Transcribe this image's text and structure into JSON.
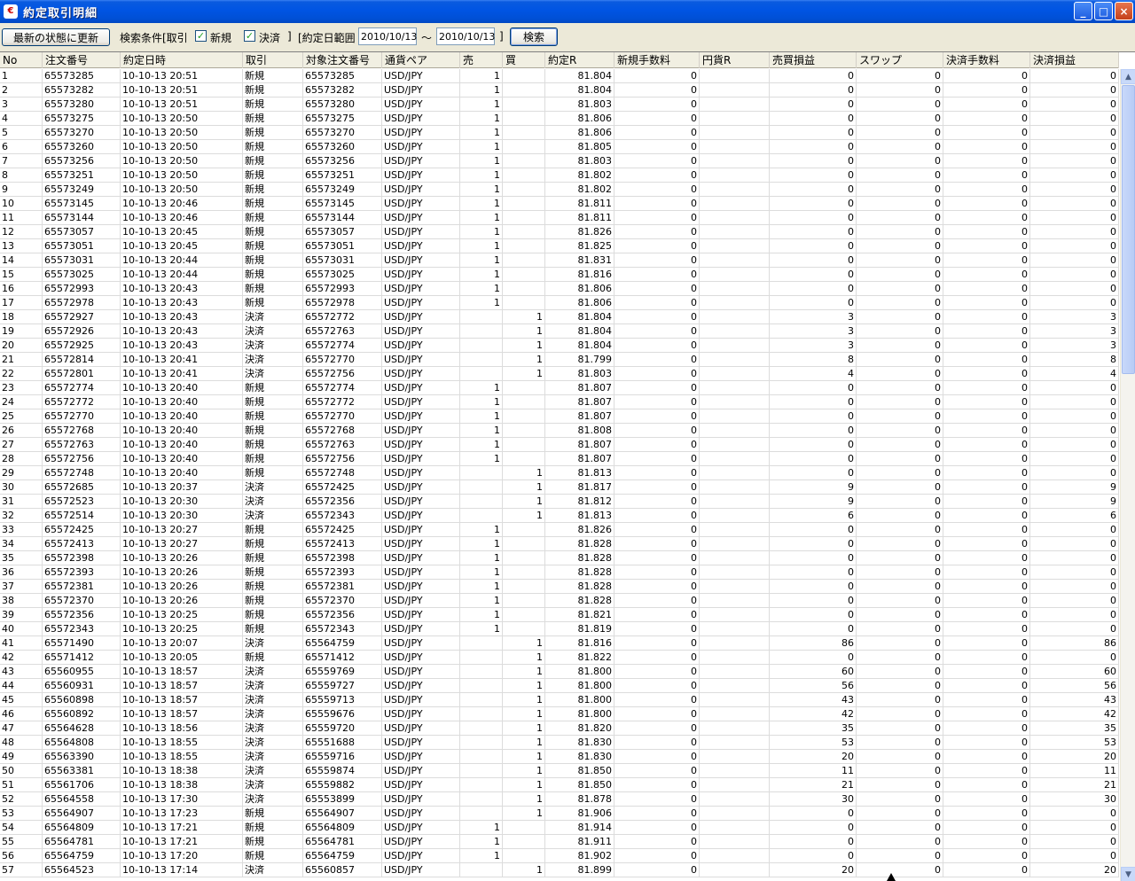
{
  "window": {
    "title": "約定取引明細",
    "icon": "app-icon",
    "min": "_",
    "max": "□",
    "close": "×"
  },
  "toolbar": {
    "refresh_label": "最新の状態に更新",
    "search_cond": "検索条件[取引",
    "chk_new_label": "新規",
    "chk_settle_label": "決済",
    "bracket_close": "]",
    "date_range_label": "[約定日範囲",
    "date_from": "2010/10/13",
    "tilde": "～",
    "date_to": "2010/10/13",
    "bracket_end": "]",
    "search_label": "検索",
    "check_mark": "✓"
  },
  "columns": [
    "No",
    "注文番号",
    "約定日時",
    "取引",
    "対象注文番号",
    "通貨ペア",
    "売",
    "買",
    "約定R",
    "新規手数料",
    "円貨R",
    "売買損益",
    "スワップ",
    "決済手数料",
    "決済損益"
  ],
  "rows": [
    [
      "1",
      "65573285",
      "10-10-13 20:51",
      "新規",
      "65573285",
      "USD/JPY",
      "1",
      "",
      "81.804",
      "0",
      "",
      "0",
      "0",
      "0",
      "0"
    ],
    [
      "2",
      "65573282",
      "10-10-13 20:51",
      "新規",
      "65573282",
      "USD/JPY",
      "1",
      "",
      "81.804",
      "0",
      "",
      "0",
      "0",
      "0",
      "0"
    ],
    [
      "3",
      "65573280",
      "10-10-13 20:51",
      "新規",
      "65573280",
      "USD/JPY",
      "1",
      "",
      "81.803",
      "0",
      "",
      "0",
      "0",
      "0",
      "0"
    ],
    [
      "4",
      "65573275",
      "10-10-13 20:50",
      "新規",
      "65573275",
      "USD/JPY",
      "1",
      "",
      "81.806",
      "0",
      "",
      "0",
      "0",
      "0",
      "0"
    ],
    [
      "5",
      "65573270",
      "10-10-13 20:50",
      "新規",
      "65573270",
      "USD/JPY",
      "1",
      "",
      "81.806",
      "0",
      "",
      "0",
      "0",
      "0",
      "0"
    ],
    [
      "6",
      "65573260",
      "10-10-13 20:50",
      "新規",
      "65573260",
      "USD/JPY",
      "1",
      "",
      "81.805",
      "0",
      "",
      "0",
      "0",
      "0",
      "0"
    ],
    [
      "7",
      "65573256",
      "10-10-13 20:50",
      "新規",
      "65573256",
      "USD/JPY",
      "1",
      "",
      "81.803",
      "0",
      "",
      "0",
      "0",
      "0",
      "0"
    ],
    [
      "8",
      "65573251",
      "10-10-13 20:50",
      "新規",
      "65573251",
      "USD/JPY",
      "1",
      "",
      "81.802",
      "0",
      "",
      "0",
      "0",
      "0",
      "0"
    ],
    [
      "9",
      "65573249",
      "10-10-13 20:50",
      "新規",
      "65573249",
      "USD/JPY",
      "1",
      "",
      "81.802",
      "0",
      "",
      "0",
      "0",
      "0",
      "0"
    ],
    [
      "10",
      "65573145",
      "10-10-13 20:46",
      "新規",
      "65573145",
      "USD/JPY",
      "1",
      "",
      "81.811",
      "0",
      "",
      "0",
      "0",
      "0",
      "0"
    ],
    [
      "11",
      "65573144",
      "10-10-13 20:46",
      "新規",
      "65573144",
      "USD/JPY",
      "1",
      "",
      "81.811",
      "0",
      "",
      "0",
      "0",
      "0",
      "0"
    ],
    [
      "12",
      "65573057",
      "10-10-13 20:45",
      "新規",
      "65573057",
      "USD/JPY",
      "1",
      "",
      "81.826",
      "0",
      "",
      "0",
      "0",
      "0",
      "0"
    ],
    [
      "13",
      "65573051",
      "10-10-13 20:45",
      "新規",
      "65573051",
      "USD/JPY",
      "1",
      "",
      "81.825",
      "0",
      "",
      "0",
      "0",
      "0",
      "0"
    ],
    [
      "14",
      "65573031",
      "10-10-13 20:44",
      "新規",
      "65573031",
      "USD/JPY",
      "1",
      "",
      "81.831",
      "0",
      "",
      "0",
      "0",
      "0",
      "0"
    ],
    [
      "15",
      "65573025",
      "10-10-13 20:44",
      "新規",
      "65573025",
      "USD/JPY",
      "1",
      "",
      "81.816",
      "0",
      "",
      "0",
      "0",
      "0",
      "0"
    ],
    [
      "16",
      "65572993",
      "10-10-13 20:43",
      "新規",
      "65572993",
      "USD/JPY",
      "1",
      "",
      "81.806",
      "0",
      "",
      "0",
      "0",
      "0",
      "0"
    ],
    [
      "17",
      "65572978",
      "10-10-13 20:43",
      "新規",
      "65572978",
      "USD/JPY",
      "1",
      "",
      "81.806",
      "0",
      "",
      "0",
      "0",
      "0",
      "0"
    ],
    [
      "18",
      "65572927",
      "10-10-13 20:43",
      "決済",
      "65572772",
      "USD/JPY",
      "",
      "1",
      "81.804",
      "0",
      "",
      "3",
      "0",
      "0",
      "3"
    ],
    [
      "19",
      "65572926",
      "10-10-13 20:43",
      "決済",
      "65572763",
      "USD/JPY",
      "",
      "1",
      "81.804",
      "0",
      "",
      "3",
      "0",
      "0",
      "3"
    ],
    [
      "20",
      "65572925",
      "10-10-13 20:43",
      "決済",
      "65572774",
      "USD/JPY",
      "",
      "1",
      "81.804",
      "0",
      "",
      "3",
      "0",
      "0",
      "3"
    ],
    [
      "21",
      "65572814",
      "10-10-13 20:41",
      "決済",
      "65572770",
      "USD/JPY",
      "",
      "1",
      "81.799",
      "0",
      "",
      "8",
      "0",
      "0",
      "8"
    ],
    [
      "22",
      "65572801",
      "10-10-13 20:41",
      "決済",
      "65572756",
      "USD/JPY",
      "",
      "1",
      "81.803",
      "0",
      "",
      "4",
      "0",
      "0",
      "4"
    ],
    [
      "23",
      "65572774",
      "10-10-13 20:40",
      "新規",
      "65572774",
      "USD/JPY",
      "1",
      "",
      "81.807",
      "0",
      "",
      "0",
      "0",
      "0",
      "0"
    ],
    [
      "24",
      "65572772",
      "10-10-13 20:40",
      "新規",
      "65572772",
      "USD/JPY",
      "1",
      "",
      "81.807",
      "0",
      "",
      "0",
      "0",
      "0",
      "0"
    ],
    [
      "25",
      "65572770",
      "10-10-13 20:40",
      "新規",
      "65572770",
      "USD/JPY",
      "1",
      "",
      "81.807",
      "0",
      "",
      "0",
      "0",
      "0",
      "0"
    ],
    [
      "26",
      "65572768",
      "10-10-13 20:40",
      "新規",
      "65572768",
      "USD/JPY",
      "1",
      "",
      "81.808",
      "0",
      "",
      "0",
      "0",
      "0",
      "0"
    ],
    [
      "27",
      "65572763",
      "10-10-13 20:40",
      "新規",
      "65572763",
      "USD/JPY",
      "1",
      "",
      "81.807",
      "0",
      "",
      "0",
      "0",
      "0",
      "0"
    ],
    [
      "28",
      "65572756",
      "10-10-13 20:40",
      "新規",
      "65572756",
      "USD/JPY",
      "1",
      "",
      "81.807",
      "0",
      "",
      "0",
      "0",
      "0",
      "0"
    ],
    [
      "29",
      "65572748",
      "10-10-13 20:40",
      "新規",
      "65572748",
      "USD/JPY",
      "",
      "1",
      "81.813",
      "0",
      "",
      "0",
      "0",
      "0",
      "0"
    ],
    [
      "30",
      "65572685",
      "10-10-13 20:37",
      "決済",
      "65572425",
      "USD/JPY",
      "",
      "1",
      "81.817",
      "0",
      "",
      "9",
      "0",
      "0",
      "9"
    ],
    [
      "31",
      "65572523",
      "10-10-13 20:30",
      "決済",
      "65572356",
      "USD/JPY",
      "",
      "1",
      "81.812",
      "0",
      "",
      "9",
      "0",
      "0",
      "9"
    ],
    [
      "32",
      "65572514",
      "10-10-13 20:30",
      "決済",
      "65572343",
      "USD/JPY",
      "",
      "1",
      "81.813",
      "0",
      "",
      "6",
      "0",
      "0",
      "6"
    ],
    [
      "33",
      "65572425",
      "10-10-13 20:27",
      "新規",
      "65572425",
      "USD/JPY",
      "1",
      "",
      "81.826",
      "0",
      "",
      "0",
      "0",
      "0",
      "0"
    ],
    [
      "34",
      "65572413",
      "10-10-13 20:27",
      "新規",
      "65572413",
      "USD/JPY",
      "1",
      "",
      "81.828",
      "0",
      "",
      "0",
      "0",
      "0",
      "0"
    ],
    [
      "35",
      "65572398",
      "10-10-13 20:26",
      "新規",
      "65572398",
      "USD/JPY",
      "1",
      "",
      "81.828",
      "0",
      "",
      "0",
      "0",
      "0",
      "0"
    ],
    [
      "36",
      "65572393",
      "10-10-13 20:26",
      "新規",
      "65572393",
      "USD/JPY",
      "1",
      "",
      "81.828",
      "0",
      "",
      "0",
      "0",
      "0",
      "0"
    ],
    [
      "37",
      "65572381",
      "10-10-13 20:26",
      "新規",
      "65572381",
      "USD/JPY",
      "1",
      "",
      "81.828",
      "0",
      "",
      "0",
      "0",
      "0",
      "0"
    ],
    [
      "38",
      "65572370",
      "10-10-13 20:26",
      "新規",
      "65572370",
      "USD/JPY",
      "1",
      "",
      "81.828",
      "0",
      "",
      "0",
      "0",
      "0",
      "0"
    ],
    [
      "39",
      "65572356",
      "10-10-13 20:25",
      "新規",
      "65572356",
      "USD/JPY",
      "1",
      "",
      "81.821",
      "0",
      "",
      "0",
      "0",
      "0",
      "0"
    ],
    [
      "40",
      "65572343",
      "10-10-13 20:25",
      "新規",
      "65572343",
      "USD/JPY",
      "1",
      "",
      "81.819",
      "0",
      "",
      "0",
      "0",
      "0",
      "0"
    ],
    [
      "41",
      "65571490",
      "10-10-13 20:07",
      "決済",
      "65564759",
      "USD/JPY",
      "",
      "1",
      "81.816",
      "0",
      "",
      "86",
      "0",
      "0",
      "86"
    ],
    [
      "42",
      "65571412",
      "10-10-13 20:05",
      "新規",
      "65571412",
      "USD/JPY",
      "",
      "1",
      "81.822",
      "0",
      "",
      "0",
      "0",
      "0",
      "0"
    ],
    [
      "43",
      "65560955",
      "10-10-13 18:57",
      "決済",
      "65559769",
      "USD/JPY",
      "",
      "1",
      "81.800",
      "0",
      "",
      "60",
      "0",
      "0",
      "60"
    ],
    [
      "44",
      "65560931",
      "10-10-13 18:57",
      "決済",
      "65559727",
      "USD/JPY",
      "",
      "1",
      "81.800",
      "0",
      "",
      "56",
      "0",
      "0",
      "56"
    ],
    [
      "45",
      "65560898",
      "10-10-13 18:57",
      "決済",
      "65559713",
      "USD/JPY",
      "",
      "1",
      "81.800",
      "0",
      "",
      "43",
      "0",
      "0",
      "43"
    ],
    [
      "46",
      "65560892",
      "10-10-13 18:57",
      "決済",
      "65559676",
      "USD/JPY",
      "",
      "1",
      "81.800",
      "0",
      "",
      "42",
      "0",
      "0",
      "42"
    ],
    [
      "47",
      "65564628",
      "10-10-13 18:56",
      "決済",
      "65559720",
      "USD/JPY",
      "",
      "1",
      "81.820",
      "0",
      "",
      "35",
      "0",
      "0",
      "35"
    ],
    [
      "48",
      "65564808",
      "10-10-13 18:55",
      "決済",
      "65551688",
      "USD/JPY",
      "",
      "1",
      "81.830",
      "0",
      "",
      "53",
      "0",
      "0",
      "53"
    ],
    [
      "49",
      "65563390",
      "10-10-13 18:55",
      "決済",
      "65559716",
      "USD/JPY",
      "",
      "1",
      "81.830",
      "0",
      "",
      "20",
      "0",
      "0",
      "20"
    ],
    [
      "50",
      "65563381",
      "10-10-13 18:38",
      "決済",
      "65559874",
      "USD/JPY",
      "",
      "1",
      "81.850",
      "0",
      "",
      "11",
      "0",
      "0",
      "11"
    ],
    [
      "51",
      "65561706",
      "10-10-13 18:38",
      "決済",
      "65559882",
      "USD/JPY",
      "",
      "1",
      "81.850",
      "0",
      "",
      "21",
      "0",
      "0",
      "21"
    ],
    [
      "52",
      "65564558",
      "10-10-13 17:30",
      "決済",
      "65553899",
      "USD/JPY",
      "",
      "1",
      "81.878",
      "0",
      "",
      "30",
      "0",
      "0",
      "30"
    ],
    [
      "53",
      "65564907",
      "10-10-13 17:23",
      "新規",
      "65564907",
      "USD/JPY",
      "",
      "1",
      "81.906",
      "0",
      "",
      "0",
      "0",
      "0",
      "0"
    ],
    [
      "54",
      "65564809",
      "10-10-13 17:21",
      "新規",
      "65564809",
      "USD/JPY",
      "1",
      "",
      "81.914",
      "0",
      "",
      "0",
      "0",
      "0",
      "0"
    ],
    [
      "55",
      "65564781",
      "10-10-13 17:21",
      "新規",
      "65564781",
      "USD/JPY",
      "1",
      "",
      "81.911",
      "0",
      "",
      "0",
      "0",
      "0",
      "0"
    ],
    [
      "56",
      "65564759",
      "10-10-13 17:20",
      "新規",
      "65564759",
      "USD/JPY",
      "1",
      "",
      "81.902",
      "0",
      "",
      "0",
      "0",
      "0",
      "0"
    ],
    [
      "57",
      "65564523",
      "10-10-13 17:14",
      "決済",
      "65560857",
      "USD/JPY",
      "",
      "1",
      "81.899",
      "0",
      "",
      "20",
      "0",
      "0",
      "20"
    ]
  ],
  "scrollbar": {
    "up": "▲",
    "down": "▼"
  }
}
